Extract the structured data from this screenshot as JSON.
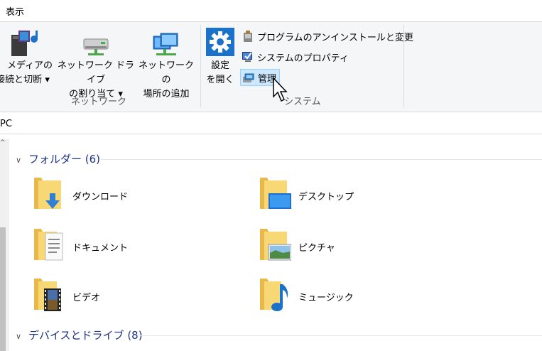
{
  "tabs": {
    "view": "表示"
  },
  "ribbon": {
    "media": {
      "line1": "メディアの",
      "line2": "接続と切断"
    },
    "map_drive": {
      "line1": "ネットワーク ドライブ",
      "line2": "の割り当て"
    },
    "add_location": {
      "line1": "ネットワークの",
      "line2": "場所の追加"
    },
    "network_group": "ネットワーク",
    "settings": {
      "line1": "設定",
      "line2": "を開く"
    },
    "uninstall": "プログラムのアンインストールと変更",
    "sys_props": "システムのプロパティ",
    "manage": "管理",
    "system_group": "システム"
  },
  "address": {
    "path": "PC"
  },
  "folders_section": {
    "title": "フォルダー (6)"
  },
  "devices_section": {
    "title": "デバイスとドライブ (8)"
  },
  "folders": [
    {
      "label": "ダウンロード",
      "icon": "download-arrow-icon"
    },
    {
      "label": "デスクトップ",
      "icon": "desktop-icon"
    },
    {
      "label": "ドキュメント",
      "icon": "document-icon"
    },
    {
      "label": "ピクチャ",
      "icon": "picture-icon"
    },
    {
      "label": "ビデオ",
      "icon": "video-film-icon"
    },
    {
      "label": "ミュージック",
      "icon": "music-note-icon"
    }
  ],
  "colors": {
    "accent": "#1e3287",
    "selected": "#cce8ff",
    "folder": "#f8d775",
    "blue": "#2f7fd4"
  }
}
